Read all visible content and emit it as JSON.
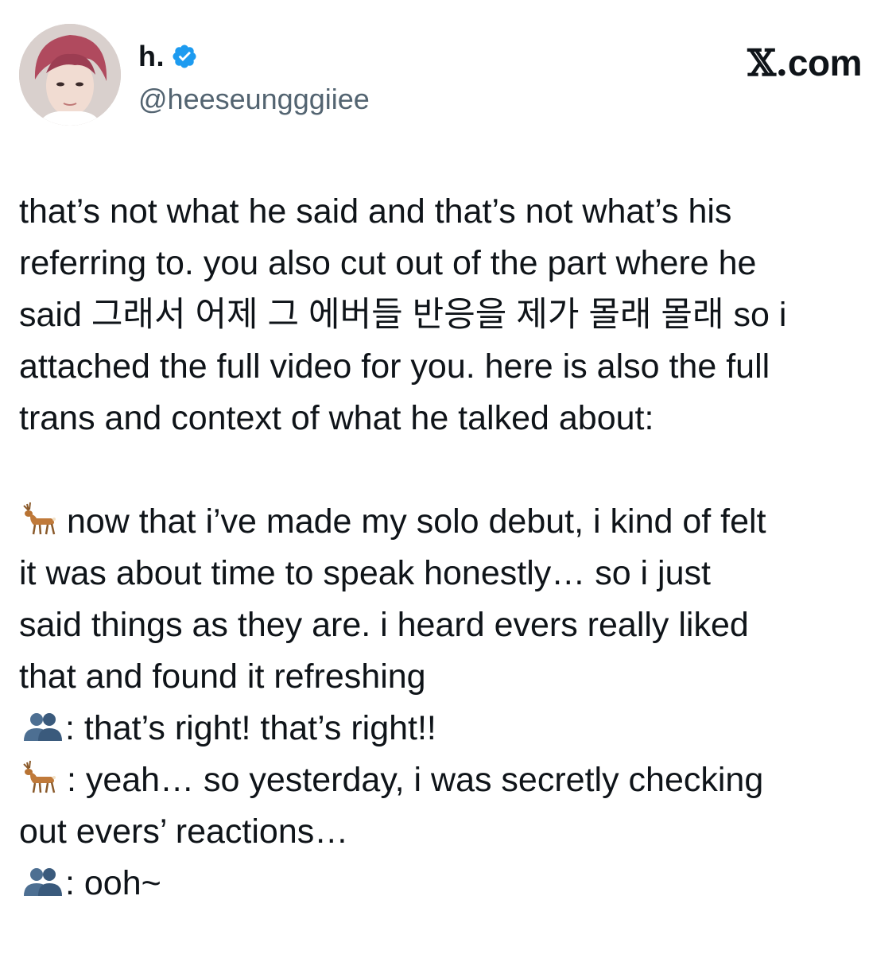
{
  "header": {
    "display_name": "h.",
    "handle": "@heeseungggiiee",
    "brand": "com",
    "brand_x": "𝕏."
  },
  "colors": {
    "verified_badge": "#1d9bf0",
    "handle_gray": "#536471",
    "text": "#0f1419"
  },
  "icons": {
    "verified": "verified-badge-icon",
    "deer": "deer-emoji-icon",
    "people": "busts-in-silhouette-emoji-icon"
  },
  "tweet": {
    "lines_p1": [
      "that’s not what he said and that’s not what’s his",
      "referring to. you also cut out of the part where he",
      "said 그래서 어제 그 에버들 반응을 제가 몰래 몰래 so i",
      "attached the full video for you. here is also the full",
      "trans and context of what he talked about:"
    ],
    "deer_line1": " now that i’ve made my solo debut, i kind of felt",
    "lines_p2": [
      "it was about time to speak honestly… so i just",
      "said things as they are. i heard evers really liked",
      "that and found it refreshing"
    ],
    "people_line1": ": that’s right! that’s right!!",
    "deer_line2": " : yeah… so yesterday, i was secretly checking",
    "line_after_deer2": "out evers’ reactions…",
    "people_line2": ": ooh~"
  }
}
